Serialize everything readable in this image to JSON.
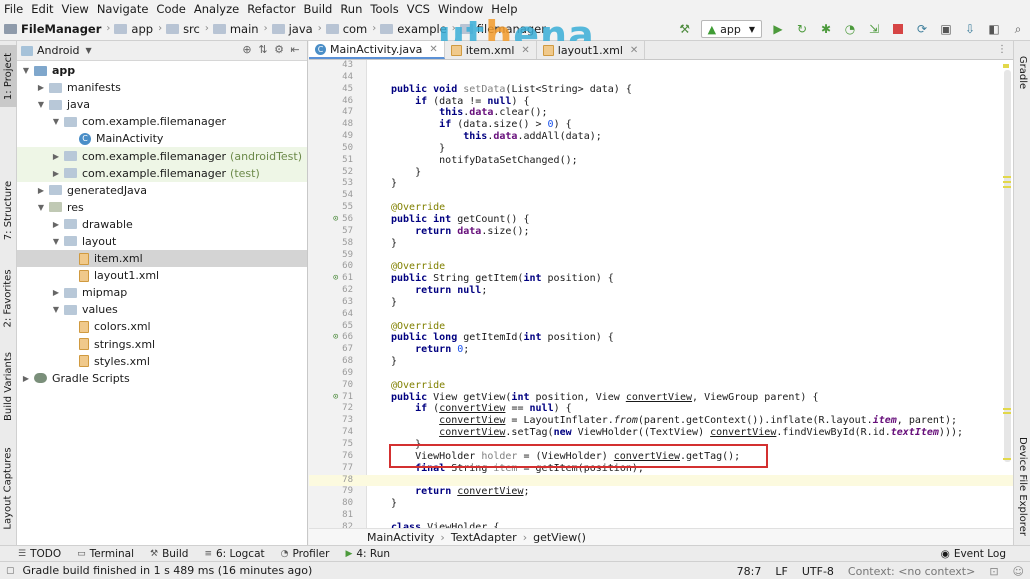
{
  "menu": [
    "File",
    "Edit",
    "View",
    "Navigate",
    "Code",
    "Analyze",
    "Refactor",
    "Build",
    "Run",
    "Tools",
    "VCS",
    "Window",
    "Help"
  ],
  "nav": {
    "crumbs": [
      "FileManager",
      "app",
      "src",
      "main",
      "java",
      "com",
      "example",
      "filemanager"
    ],
    "watermark_left": "ut",
    "watermark_o": "h",
    "watermark_rest": "ena",
    "run_config": "app"
  },
  "project_panel": {
    "view_mode": "Android",
    "tree": [
      {
        "label": "app",
        "suffix": ""
      },
      {
        "label": "manifests",
        "suffix": ""
      },
      {
        "label": "java",
        "suffix": ""
      },
      {
        "label": "com.example.filemanager",
        "suffix": ""
      },
      {
        "label": "MainActivity",
        "suffix": ""
      },
      {
        "label": "com.example.filemanager",
        "suffix": "(androidTest)"
      },
      {
        "label": "com.example.filemanager",
        "suffix": "(test)"
      },
      {
        "label": "generatedJava",
        "suffix": ""
      },
      {
        "label": "res",
        "suffix": ""
      },
      {
        "label": "drawable",
        "suffix": ""
      },
      {
        "label": "layout",
        "suffix": ""
      },
      {
        "label": "item.xml",
        "suffix": ""
      },
      {
        "label": "layout1.xml",
        "suffix": ""
      },
      {
        "label": "mipmap",
        "suffix": ""
      },
      {
        "label": "values",
        "suffix": ""
      },
      {
        "label": "colors.xml",
        "suffix": ""
      },
      {
        "label": "strings.xml",
        "suffix": ""
      },
      {
        "label": "styles.xml",
        "suffix": ""
      },
      {
        "label": "Gradle Scripts",
        "suffix": ""
      }
    ]
  },
  "left_tabs": [
    "1: Project",
    "7: Structure",
    "2: Favorites",
    "Build Variants",
    "Layout Captures"
  ],
  "right_tabs": [
    "Gradle",
    "Device File Explorer"
  ],
  "editor_tabs": [
    "MainActivity.java",
    "item.xml",
    "layout1.xml"
  ],
  "code_lines": [
    {
      "n": "43",
      "html": ""
    },
    {
      "n": "44",
      "html": ""
    },
    {
      "n": "45",
      "html": "<span class='k'>public void</span> <span class='gr'>setData</span>(List&lt;String&gt; data) {"
    },
    {
      "n": "46",
      "html": "    <span class='k'>if</span> (data != <span class='k'>null</span>) {"
    },
    {
      "n": "47",
      "html": "        <span class='k'>this</span>.<span class='f'>data</span>.clear();"
    },
    {
      "n": "48",
      "html": "        <span class='k'>if</span> (data.size() &gt; <span class='m'>0</span>) {"
    },
    {
      "n": "49",
      "html": "            <span class='k'>this</span>.<span class='f'>data</span>.addAll(data);"
    },
    {
      "n": "50",
      "html": "        }"
    },
    {
      "n": "51",
      "html": "        notifyDataSetChanged();"
    },
    {
      "n": "52",
      "html": "    }"
    },
    {
      "n": "53",
      "html": "}"
    },
    {
      "n": "54",
      "html": ""
    },
    {
      "n": "55",
      "html": "<span class='ann'>@Override</span>"
    },
    {
      "n": "56",
      "html": "<span class='k'>public int</span> getCount() {"
    },
    {
      "n": "57",
      "html": "    <span class='k'>return</span> <span class='f'>data</span>.size();"
    },
    {
      "n": "58",
      "html": "}"
    },
    {
      "n": "59",
      "html": ""
    },
    {
      "n": "60",
      "html": "<span class='ann'>@Override</span>"
    },
    {
      "n": "61",
      "html": "<span class='k'>public</span> String getItem(<span class='k'>int</span> position) {"
    },
    {
      "n": "62",
      "html": "    <span class='k'>return null</span>;"
    },
    {
      "n": "63",
      "html": "}"
    },
    {
      "n": "64",
      "html": ""
    },
    {
      "n": "65",
      "html": "<span class='ann'>@Override</span>"
    },
    {
      "n": "66",
      "html": "<span class='k'>public long</span> getItemId(<span class='k'>int</span> position) {"
    },
    {
      "n": "67",
      "html": "    <span class='k'>return</span> <span class='m'>0</span>;"
    },
    {
      "n": "68",
      "html": "}"
    },
    {
      "n": "69",
      "html": ""
    },
    {
      "n": "70",
      "html": "<span class='ann'>@Override</span>"
    },
    {
      "n": "71",
      "html": "<span class='k'>public</span> View getView(<span class='k'>int</span> position, View <span class='u'>convertView</span>, ViewGroup parent) {"
    },
    {
      "n": "72",
      "html": "    <span class='k'>if</span> (<span class='u'>convertView</span> == <span class='k'>null</span>) {"
    },
    {
      "n": "73",
      "html": "        <span class='u'>convertView</span> = LayoutInflater.<span class='st'>from</span>(parent.getContext()).inflate(R.layout.<span class='f st'>item</span>, parent);"
    },
    {
      "n": "74",
      "html": "        <span class='u'>convertView</span>.setTag(<span class='k'>new</span> ViewHolder((TextView) <span class='u'>convertView</span>.findViewById(R.id.<span class='f st'>textItem</span>)));"
    },
    {
      "n": "75",
      "html": "    }"
    },
    {
      "n": "76",
      "html": "    ViewHolder <span class='gr'>holder</span> = (ViewHolder) <span class='u'>convertView</span>.getTag();"
    },
    {
      "n": "77",
      "html": "    <span class='k'>final</span> String <span class='gr'>item</span> = getItem(position);"
    },
    {
      "n": "78",
      "html": ""
    },
    {
      "n": "79",
      "html": "    <span class='k'>return</span> <span class='u'>convertView</span>;"
    },
    {
      "n": "80",
      "html": "}"
    },
    {
      "n": "81",
      "html": ""
    },
    {
      "n": "82",
      "html": "<span class='k'>class</span> ViewHolder {"
    }
  ],
  "code_plain": [
    "",
    "",
    "public void setData(List<String> data) {",
    "    if (data != null) {",
    "        this.data.clear();",
    "        if (data.size() > 0) {",
    "            this.data.addAll(data);",
    "        }",
    "        notifyDataSetChanged();",
    "    }",
    "}",
    "",
    "@Override",
    "public int getCount() {",
    "    return data.size();",
    "}",
    "",
    "@Override",
    "public String getItem(int position) {",
    "    return null;",
    "}",
    "",
    "@Override",
    "public long getItemId(int position) {",
    "    return 0;",
    "}",
    "",
    "@Override",
    "public View getView(int position, View convertView, ViewGroup parent) {",
    "    if (convertView == null) {",
    "        convertView = LayoutInflater.from(parent.getContext()).inflate(R.layout.item, parent);",
    "        convertView.setTag(new ViewHolder((TextView) convertView.findViewById(R.id.textItem)));",
    "    }",
    "    ViewHolder holder = (ViewHolder) convertView.getTag();",
    "    final String item = getItem(position);",
    "",
    "    return convertView;",
    "}",
    "",
    "class ViewHolder {"
  ],
  "breadcrumb": [
    "MainActivity",
    "TextAdapter",
    "getView()"
  ],
  "bottom_tabs": [
    "TODO",
    "Terminal",
    "Build",
    "6: Logcat",
    "Profiler",
    "4: Run"
  ],
  "event_log": "Event Log",
  "status": {
    "message": "Gradle build finished in 1 s 489 ms (16 minutes ago)",
    "position": "78:7",
    "line_sep": "LF",
    "encoding": "UTF-8",
    "context": "Context: <no context>"
  },
  "colors": {
    "highlight_box": "#d33030",
    "keyword": "#000080",
    "annotation": "#808000",
    "field": "#660e7a",
    "number": "#1750eb"
  }
}
